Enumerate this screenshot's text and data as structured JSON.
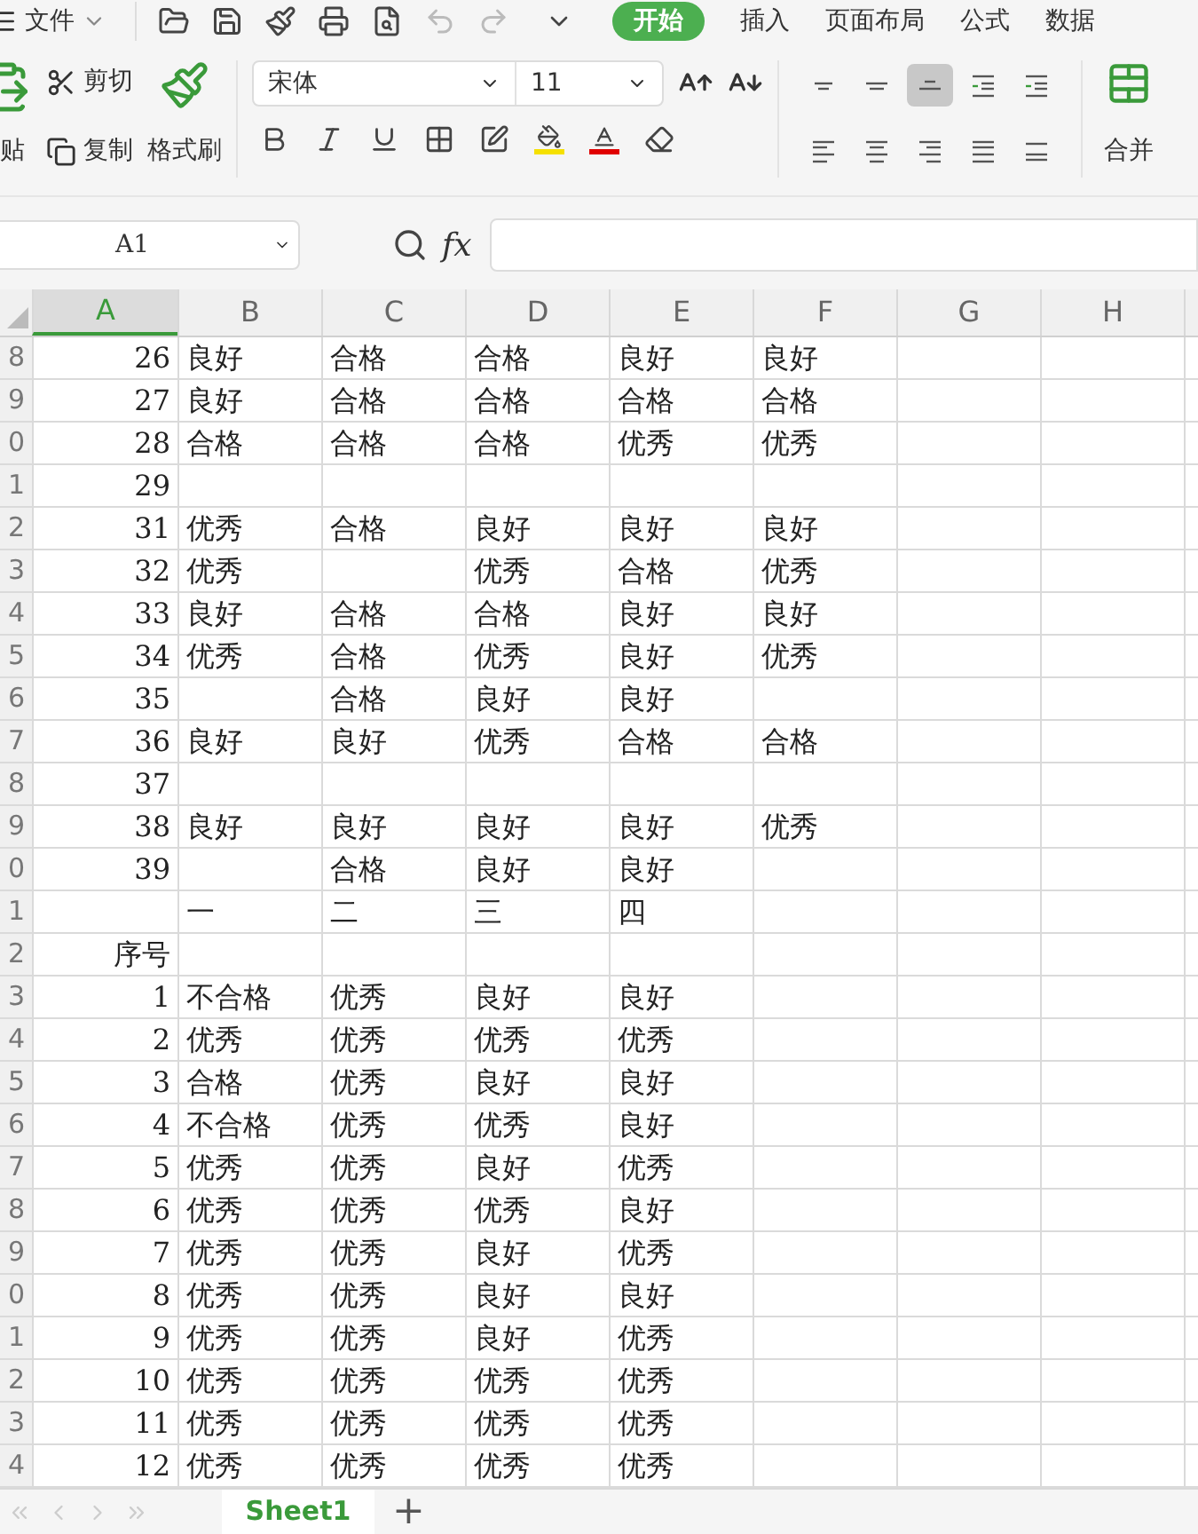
{
  "menu_bar": {
    "file_menu": "文件",
    "tabs": [
      {
        "label": "开始",
        "selected": true
      },
      {
        "label": "插入",
        "selected": false
      },
      {
        "label": "页面布局",
        "selected": false
      },
      {
        "label": "公式",
        "selected": false
      },
      {
        "label": "数据",
        "selected": false
      }
    ]
  },
  "ribbon": {
    "clipboard": {
      "paste": "贴",
      "cut": "剪切",
      "copy": "复制",
      "format_painter": "格式刷"
    },
    "font": {
      "font_name": "宋体",
      "font_size": "11"
    },
    "alignment": [
      {
        "kind": "top",
        "selected": false
      },
      {
        "kind": "middle",
        "selected": false
      },
      {
        "kind": "bottom",
        "selected": true
      },
      {
        "kind": "outdent",
        "selected": false
      },
      {
        "kind": "indent",
        "selected": false
      },
      {
        "kind": "left",
        "selected": false
      },
      {
        "kind": "center",
        "selected": false
      },
      {
        "kind": "right",
        "selected": false
      },
      {
        "kind": "justify",
        "selected": false
      },
      {
        "kind": "distribute",
        "selected": false
      }
    ],
    "merge": "合并"
  },
  "formula_bar": {
    "name_box": "A1",
    "fx": "fx"
  },
  "sheet": {
    "columns": [
      {
        "label": "A",
        "selected": true
      },
      {
        "label": "B",
        "selected": false
      },
      {
        "label": "C",
        "selected": false
      },
      {
        "label": "D",
        "selected": false
      },
      {
        "label": "E",
        "selected": false
      },
      {
        "label": "F",
        "selected": false
      },
      {
        "label": "G",
        "selected": false
      },
      {
        "label": "H",
        "selected": false
      }
    ],
    "rows": [
      {
        "header": "8",
        "cells": [
          "26",
          "良好",
          "合格",
          "合格",
          "良好",
          "良好"
        ]
      },
      {
        "header": "9",
        "cells": [
          "27",
          "良好",
          "合格",
          "合格",
          "合格",
          "合格"
        ]
      },
      {
        "header": "0",
        "cells": [
          "28",
          "合格",
          "合格",
          "合格",
          "优秀",
          "优秀"
        ]
      },
      {
        "header": "1",
        "cells": [
          "29",
          "",
          "",
          "",
          "",
          ""
        ]
      },
      {
        "header": "2",
        "cells": [
          "31",
          "优秀",
          "合格",
          "良好",
          "良好",
          "良好"
        ]
      },
      {
        "header": "3",
        "cells": [
          "32",
          "优秀",
          "",
          "优秀",
          "合格",
          "优秀"
        ]
      },
      {
        "header": "4",
        "cells": [
          "33",
          "良好",
          "合格",
          "合格",
          "良好",
          "良好"
        ]
      },
      {
        "header": "5",
        "cells": [
          "34",
          "优秀",
          "合格",
          "优秀",
          "良好",
          "优秀"
        ]
      },
      {
        "header": "6",
        "cells": [
          "35",
          "",
          "合格",
          "良好",
          "良好",
          ""
        ]
      },
      {
        "header": "7",
        "cells": [
          "36",
          "良好",
          "良好",
          "优秀",
          "合格",
          "合格"
        ]
      },
      {
        "header": "8",
        "cells": [
          "37",
          "",
          "",
          "",
          "",
          ""
        ]
      },
      {
        "header": "9",
        "cells": [
          "38",
          "良好",
          "良好",
          "良好",
          "良好",
          "优秀"
        ]
      },
      {
        "header": "0",
        "cells": [
          "39",
          "",
          "合格",
          "良好",
          "良好",
          ""
        ]
      },
      {
        "header": "1",
        "cells": [
          "",
          "一",
          "二",
          "三",
          "四",
          ""
        ]
      },
      {
        "header": "2",
        "cells": [
          "序号",
          "",
          "",
          "",
          "",
          ""
        ]
      },
      {
        "header": "3",
        "cells": [
          "1",
          "不合格",
          "优秀",
          "良好",
          "良好",
          ""
        ]
      },
      {
        "header": "4",
        "cells": [
          "2",
          "优秀",
          "优秀",
          "优秀",
          "优秀",
          ""
        ]
      },
      {
        "header": "5",
        "cells": [
          "3",
          "合格",
          "优秀",
          "良好",
          "良好",
          ""
        ]
      },
      {
        "header": "6",
        "cells": [
          "4",
          "不合格",
          "优秀",
          "优秀",
          "良好",
          ""
        ]
      },
      {
        "header": "7",
        "cells": [
          "5",
          "优秀",
          "优秀",
          "良好",
          "优秀",
          ""
        ]
      },
      {
        "header": "8",
        "cells": [
          "6",
          "优秀",
          "优秀",
          "优秀",
          "良好",
          ""
        ]
      },
      {
        "header": "9",
        "cells": [
          "7",
          "优秀",
          "优秀",
          "良好",
          "优秀",
          ""
        ]
      },
      {
        "header": "0",
        "cells": [
          "8",
          "优秀",
          "优秀",
          "良好",
          "良好",
          ""
        ]
      },
      {
        "header": "1",
        "cells": [
          "9",
          "优秀",
          "优秀",
          "良好",
          "优秀",
          ""
        ]
      },
      {
        "header": "2",
        "cells": [
          "10",
          "优秀",
          "优秀",
          "优秀",
          "优秀",
          ""
        ]
      },
      {
        "header": "3",
        "cells": [
          "11",
          "优秀",
          "优秀",
          "优秀",
          "优秀",
          ""
        ]
      },
      {
        "header": "4",
        "cells": [
          "12",
          "优秀",
          "优秀",
          "优秀",
          "优秀",
          ""
        ]
      }
    ]
  },
  "sheet_tabs": [
    {
      "label": "Sheet1",
      "selected": true
    }
  ],
  "add_sheet": "+"
}
